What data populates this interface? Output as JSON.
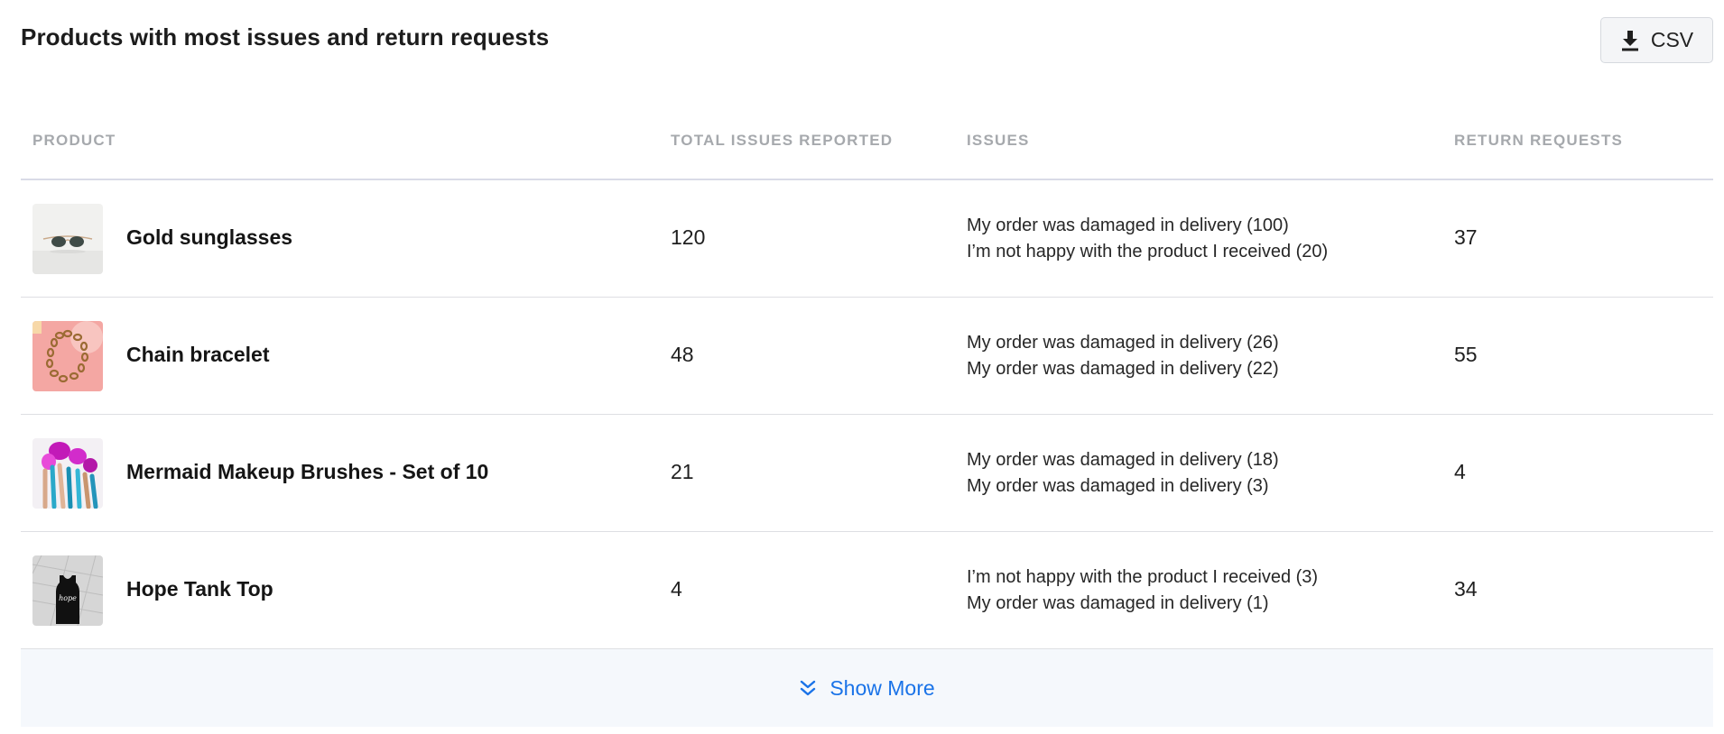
{
  "header": {
    "title": "Products with most issues and return requests",
    "csv_label": "CSV",
    "csv_icon": "download-icon"
  },
  "table": {
    "columns": [
      "PRODUCT",
      "TOTAL ISSUES REPORTED",
      "ISSUES",
      "RETURN REQUESTS"
    ],
    "rows": [
      {
        "thumbnail": "sunglasses-image",
        "product": "Gold sunglasses",
        "total": "120",
        "issues": [
          "My order was damaged in delivery (100)",
          "I’m not happy with the product I received (20)"
        ],
        "returns": "37"
      },
      {
        "thumbnail": "bracelet-image",
        "product": "Chain bracelet",
        "total": "48",
        "issues": [
          "My order was damaged in delivery (26)",
          "My order was damaged in delivery (22)"
        ],
        "returns": "55"
      },
      {
        "thumbnail": "makeup-brushes-image",
        "product": "Mermaid Makeup Brushes - Set of 10",
        "total": "21",
        "issues": [
          "My order was damaged in delivery (18)",
          "My order was damaged in delivery (3)"
        ],
        "returns": "4"
      },
      {
        "thumbnail": "tank-top-image",
        "product": "Hope Tank Top",
        "total": "4",
        "issues": [
          "I’m not happy with the product I received (3)",
          "My order was damaged in delivery (1)"
        ],
        "returns": "34"
      }
    ]
  },
  "footer": {
    "show_more_label": "Show More",
    "show_more_icon": "double-chevron-down-icon",
    "accent": "#1a73e8"
  }
}
